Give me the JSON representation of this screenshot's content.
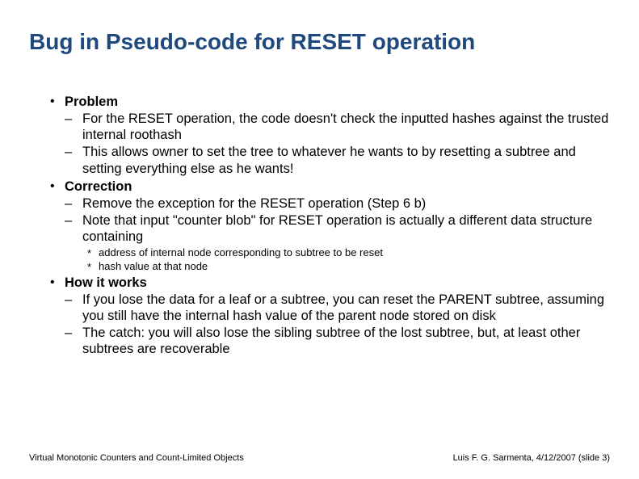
{
  "title": "Bug in Pseudo-code for RESET operation",
  "bullets": [
    {
      "label": "Problem",
      "sub": [
        {
          "text": "For the RESET operation, the code doesn't check the inputted hashes against the trusted internal roothash"
        },
        {
          "text": "This allows owner to set the tree to whatever he wants to by resetting a subtree and setting everything else as he wants!"
        }
      ]
    },
    {
      "label": "Correction",
      "sub": [
        {
          "text": "Remove the exception for the RESET operation (Step 6 b)"
        },
        {
          "text": "Note that input \"counter blob\" for RESET operation is actually a different data structure containing",
          "subsub": [
            "address of internal node corresponding to subtree to be reset",
            "hash value at that node"
          ]
        }
      ]
    },
    {
      "label": "How it works",
      "sub": [
        {
          "text": "If you lose the data for a leaf or a subtree, you can reset the PARENT subtree, assuming you still have the internal hash value of the parent node stored on disk"
        },
        {
          "text": "The catch: you will also lose the sibling subtree of the lost subtree, but, at least other subtrees are recoverable"
        }
      ]
    }
  ],
  "footer": {
    "left": "Virtual Monotonic Counters and Count-Limited Objects",
    "right": "Luis F. G. Sarmenta, 4/12/2007 (slide 3)"
  }
}
